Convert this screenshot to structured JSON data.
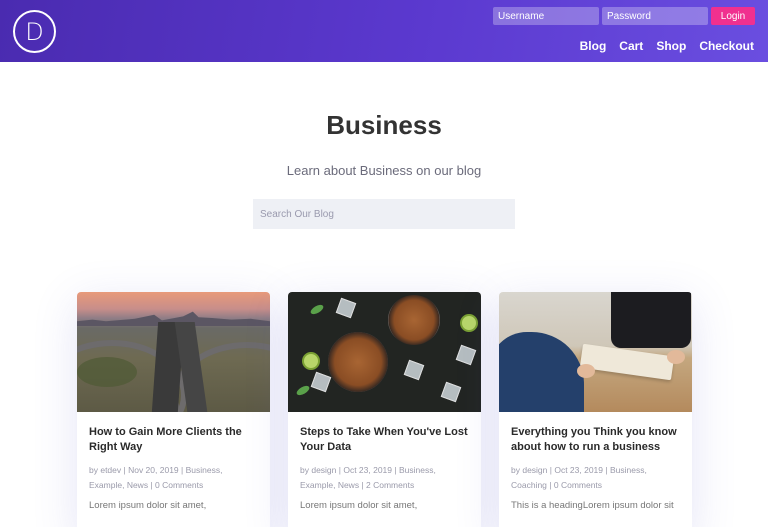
{
  "header": {
    "logo_letter": "D",
    "username_placeholder": "Username",
    "password_placeholder": "Password",
    "login_label": "Login",
    "nav": [
      "Blog",
      "Cart",
      "Shop",
      "Checkout"
    ]
  },
  "hero": {
    "title": "Business",
    "subtitle": "Learn about Business on our blog",
    "search_placeholder": "Search Our Blog"
  },
  "posts": [
    {
      "title": "How to Gain More Clients the Right Way",
      "author": "etdev",
      "date": "Nov 20, 2019",
      "categories": [
        "Business",
        "Example",
        "News"
      ],
      "comments": "0 Comments",
      "excerpt": "Lorem ipsum dolor sit amet,"
    },
    {
      "title": "Steps to Take When You've Lost Your Data",
      "author": "design",
      "date": "Oct 23, 2019",
      "categories": [
        "Business",
        "Example",
        "News"
      ],
      "comments": "2 Comments",
      "excerpt": "Lorem ipsum dolor sit amet,"
    },
    {
      "title": "Everything you Think you know about how to run a business",
      "author": "design",
      "date": "Oct 23, 2019",
      "categories": [
        "Business",
        "Coaching"
      ],
      "comments": "0 Comments",
      "excerpt": "This is a headingLorem ipsum dolor sit"
    }
  ],
  "colors": {
    "header_gradient_start": "#4a2bb0",
    "header_gradient_end": "#6a4ee0",
    "login_button": "#f0308f",
    "title_text": "#333333"
  }
}
